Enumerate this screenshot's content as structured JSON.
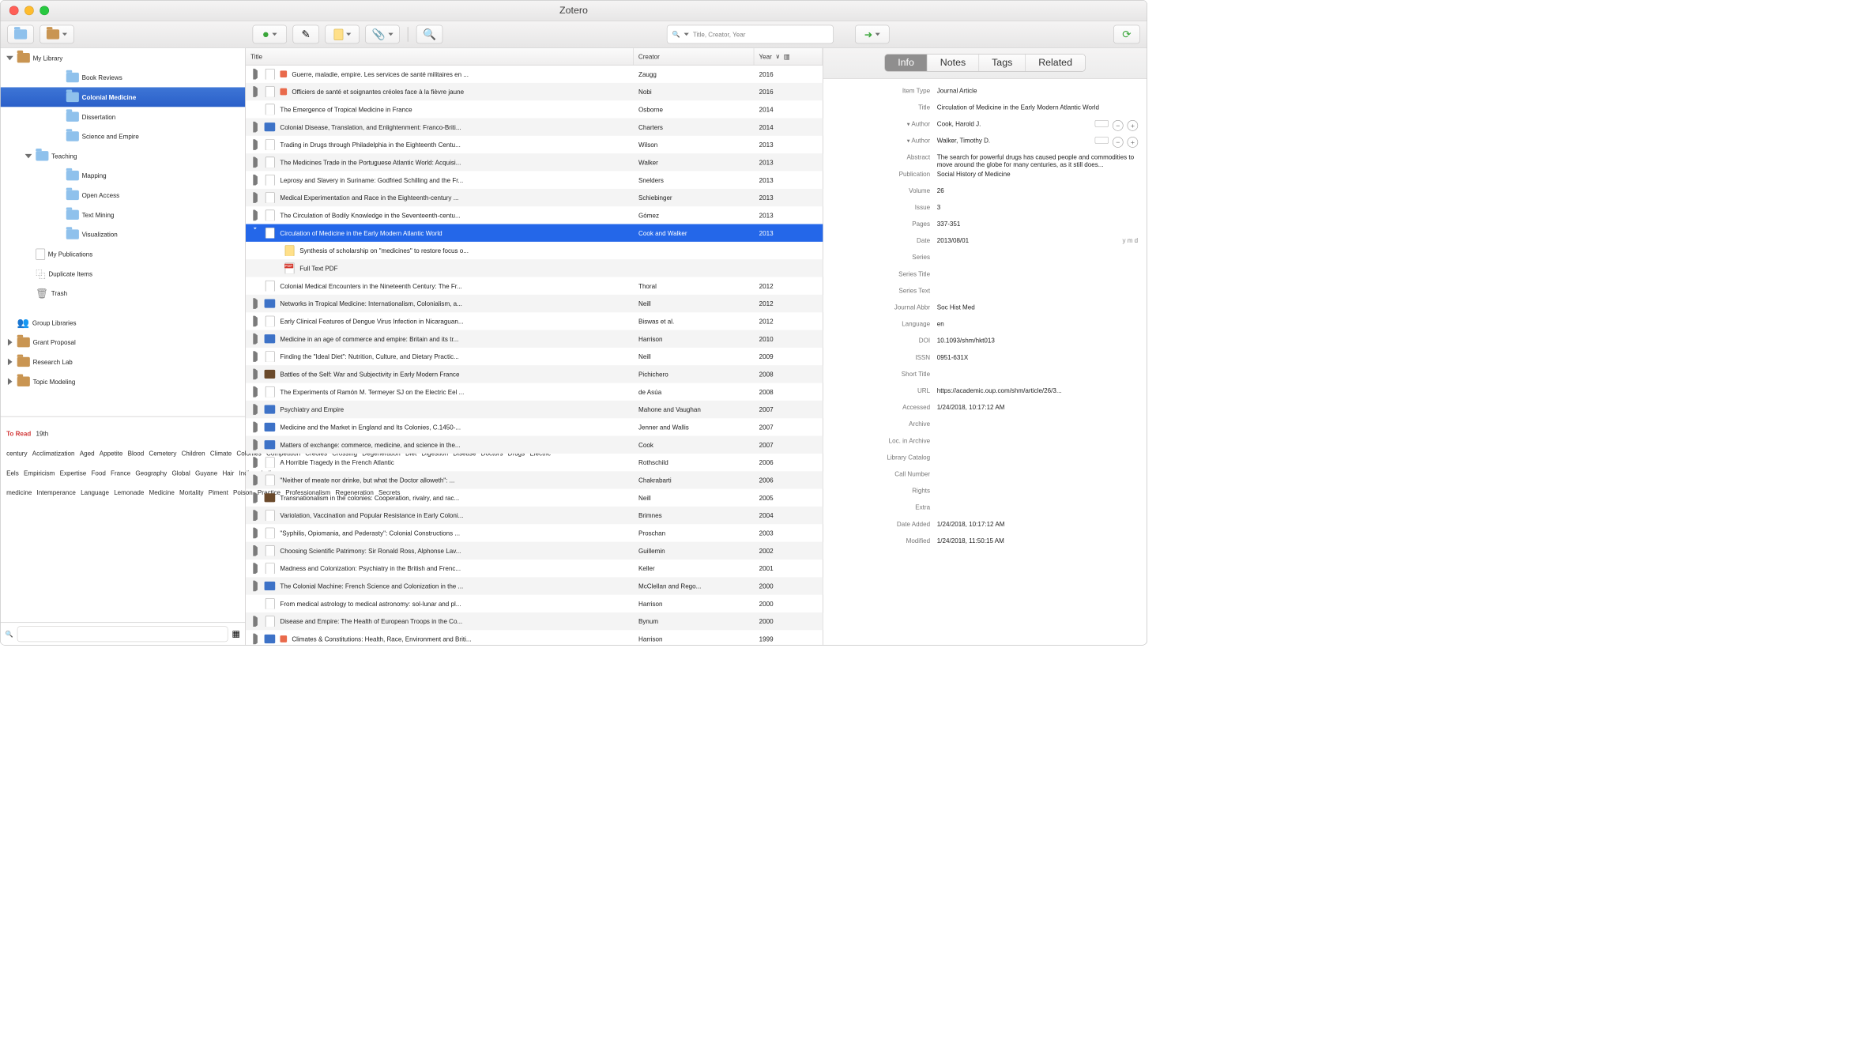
{
  "window": {
    "title": "Zotero"
  },
  "toolbar": {
    "search_placeholder": "Title, Creator, Year"
  },
  "tree": {
    "items": [
      {
        "label": "My Library",
        "depth": 0,
        "arrow": "down",
        "icon": "folder-br"
      },
      {
        "label": "Book Reviews",
        "depth": 2,
        "arrow": "none",
        "icon": "folder"
      },
      {
        "label": "Colonial Medicine",
        "depth": 2,
        "arrow": "none",
        "icon": "folder",
        "selected": true
      },
      {
        "label": "Dissertation",
        "depth": 2,
        "arrow": "none",
        "icon": "folder"
      },
      {
        "label": "Science and Empire",
        "depth": 2,
        "arrow": "none",
        "icon": "folder"
      },
      {
        "label": "Teaching",
        "depth": 1,
        "arrow": "down",
        "icon": "folder"
      },
      {
        "label": "Mapping",
        "depth": 2,
        "arrow": "none",
        "icon": "folder"
      },
      {
        "label": "Open Access",
        "depth": 2,
        "arrow": "none",
        "icon": "folder"
      },
      {
        "label": "Text Mining",
        "depth": 2,
        "arrow": "none",
        "icon": "folder"
      },
      {
        "label": "Visualization",
        "depth": 2,
        "arrow": "none",
        "icon": "folder"
      },
      {
        "label": "My Publications",
        "depth": 1,
        "arrow": "none",
        "icon": "doc"
      },
      {
        "label": "Duplicate Items",
        "depth": 1,
        "arrow": "none",
        "icon": "dup"
      },
      {
        "label": "Trash",
        "depth": 1,
        "arrow": "none",
        "icon": "trash"
      },
      {
        "label": "",
        "depth": 0,
        "arrow": "none",
        "icon": "spacer"
      },
      {
        "label": "Group Libraries",
        "depth": 0,
        "arrow": "none",
        "icon": "group"
      },
      {
        "label": "Grant Proposal",
        "depth": 0,
        "arrow": "right",
        "icon": "folder-br"
      },
      {
        "label": "Research Lab",
        "depth": 0,
        "arrow": "right",
        "icon": "folder-br"
      },
      {
        "label": "Topic Modeling",
        "depth": 0,
        "arrow": "right",
        "icon": "folder-br"
      }
    ]
  },
  "tags": [
    "To Read",
    "19th century",
    "Acclimatization",
    "Aged",
    "Appetite",
    "Blood",
    "Cemetery",
    "Children",
    "Climate",
    "Colonies",
    "Competition",
    "Creoles",
    "Crossing",
    "Degeneration",
    "Diet",
    "Digestion",
    "Disease",
    "Doctors",
    "Drugs",
    "Electric Eels",
    "Empiricism",
    "Expertise",
    "Food",
    "France",
    "Geography",
    "Global",
    "Guyane",
    "Hair",
    "Indies",
    "Indigenous medicine",
    "Intemperance",
    "Language",
    "Lemonade",
    "Medicine",
    "Mortality",
    "Piment",
    "Poison",
    "Practice",
    "Professionalism",
    "Regeneration",
    "Secrets"
  ],
  "columns": {
    "title": "Title",
    "creator": "Creator",
    "year": "Year"
  },
  "items": [
    {
      "arrow": "r",
      "icon": "doc",
      "tag": "red",
      "title": "Guerre, maladie, empire. Les services de santé militaires en ...",
      "creator": "Zaugg",
      "year": "2016"
    },
    {
      "arrow": "r",
      "icon": "doc",
      "tag": "red",
      "title": "Officiers de santé et soignantes créoles face à la fièvre jaune",
      "creator": "Nobi",
      "year": "2016"
    },
    {
      "arrow": "",
      "icon": "doc",
      "tag": "",
      "title": "The Emergence of Tropical Medicine in France",
      "creator": "Osborne",
      "year": "2014"
    },
    {
      "arrow": "r",
      "icon": "book",
      "tag": "",
      "title": "Colonial Disease, Translation, and Enlightenment: Franco-Briti...",
      "creator": "Charters",
      "year": "2014"
    },
    {
      "arrow": "r",
      "icon": "doc",
      "tag": "",
      "title": "Trading in Drugs through Philadelphia in the Eighteenth Centu...",
      "creator": "Wilson",
      "year": "2013"
    },
    {
      "arrow": "r",
      "icon": "doc",
      "tag": "",
      "title": "The Medicines Trade in the Portuguese Atlantic World: Acquisi...",
      "creator": "Walker",
      "year": "2013"
    },
    {
      "arrow": "r",
      "icon": "doc",
      "tag": "",
      "title": "Leprosy and Slavery in Suriname: Godfried Schilling and the Fr...",
      "creator": "Snelders",
      "year": "2013"
    },
    {
      "arrow": "r",
      "icon": "doc",
      "tag": "",
      "title": "Medical Experimentation and Race in the Eighteenth-century ...",
      "creator": "Schiebinger",
      "year": "2013"
    },
    {
      "arrow": "r",
      "icon": "doc",
      "tag": "",
      "title": "The Circulation of Bodily Knowledge in the Seventeenth-centu...",
      "creator": "Gómez",
      "year": "2013"
    },
    {
      "arrow": "d",
      "icon": "doc",
      "tag": "",
      "title": "Circulation of Medicine in the Early Modern Atlantic World",
      "creator": "Cook and Walker",
      "year": "2013",
      "selected": true
    },
    {
      "arrow": "",
      "icon": "note",
      "tag": "",
      "title": "Synthesis of scholarship on \"medicines\" to restore focus o...",
      "creator": "",
      "year": "",
      "child": true
    },
    {
      "arrow": "",
      "icon": "pdf",
      "tag": "",
      "title": "Full Text PDF",
      "creator": "",
      "year": "",
      "child": true
    },
    {
      "arrow": "",
      "icon": "doc",
      "tag": "",
      "title": "Colonial Medical Encounters in the Nineteenth Century: The Fr...",
      "creator": "Thoral",
      "year": "2012"
    },
    {
      "arrow": "r",
      "icon": "book",
      "tag": "",
      "title": "Networks in Tropical Medicine: Internationalism, Colonialism, a...",
      "creator": "Neill",
      "year": "2012"
    },
    {
      "arrow": "r",
      "icon": "doc",
      "tag": "",
      "title": "Early Clinical Features of Dengue Virus Infection in Nicaraguan...",
      "creator": "Biswas et al.",
      "year": "2012"
    },
    {
      "arrow": "r",
      "icon": "book",
      "tag": "",
      "title": "Medicine in an age of commerce and empire: Britain and its tr...",
      "creator": "Harrison",
      "year": "2010"
    },
    {
      "arrow": "r",
      "icon": "doc",
      "tag": "",
      "title": "Finding the \"Ideal Diet\": Nutrition, Culture, and Dietary Practic...",
      "creator": "Neill",
      "year": "2009"
    },
    {
      "arrow": "r",
      "icon": "bookdark",
      "tag": "",
      "title": "Battles of the Self: War and Subjectivity in Early Modern France",
      "creator": "Pichichero",
      "year": "2008"
    },
    {
      "arrow": "r",
      "icon": "doc",
      "tag": "",
      "title": "The Experiments of Ramón M. Termeyer SJ on the Electric Eel ...",
      "creator": "de Asúa",
      "year": "2008"
    },
    {
      "arrow": "r",
      "icon": "book",
      "tag": "",
      "title": "Psychiatry and Empire",
      "creator": "Mahone and Vaughan",
      "year": "2007"
    },
    {
      "arrow": "r",
      "icon": "book",
      "tag": "",
      "title": "Medicine and the Market in England and Its Colonies, C.1450-...",
      "creator": "Jenner and Wallis",
      "year": "2007"
    },
    {
      "arrow": "r",
      "icon": "book",
      "tag": "",
      "title": "Matters of exchange: commerce, medicine, and science in the...",
      "creator": "Cook",
      "year": "2007"
    },
    {
      "arrow": "r",
      "icon": "doc",
      "tag": "",
      "title": "A Horrible Tragedy in the French Atlantic",
      "creator": "Rothschild",
      "year": "2006"
    },
    {
      "arrow": "r",
      "icon": "doc",
      "tag": "",
      "title": "\"Neither of meate nor drinke, but what the Doctor alloweth\": ...",
      "creator": "Chakrabarti",
      "year": "2006"
    },
    {
      "arrow": "r",
      "icon": "bookdark",
      "tag": "",
      "title": "Transnationalism in the colonies: Cooperation, rivalry, and rac...",
      "creator": "Neill",
      "year": "2005"
    },
    {
      "arrow": "r",
      "icon": "doc",
      "tag": "",
      "title": "Variolation, Vaccination and Popular Resistance in Early Coloni...",
      "creator": "Brimnes",
      "year": "2004"
    },
    {
      "arrow": "r",
      "icon": "doc",
      "tag": "",
      "title": "\"Syphilis, Opiomania, and Pederasty\": Colonial Constructions ...",
      "creator": "Proschan",
      "year": "2003"
    },
    {
      "arrow": "r",
      "icon": "doc",
      "tag": "",
      "title": "Choosing Scientific Patrimony: Sir Ronald Ross, Alphonse Lav...",
      "creator": "Guillemin",
      "year": "2002"
    },
    {
      "arrow": "r",
      "icon": "doc",
      "tag": "",
      "title": "Madness and Colonization: Psychiatry in the British and Frenc...",
      "creator": "Keller",
      "year": "2001"
    },
    {
      "arrow": "r",
      "icon": "book",
      "tag": "",
      "title": "The Colonial Machine: French Science and Colonization in the ...",
      "creator": "McClellan and Rego...",
      "year": "2000"
    },
    {
      "arrow": "",
      "icon": "doc",
      "tag": "",
      "title": "From medical astrology to medical astronomy: sol-lunar and pl...",
      "creator": "Harrison",
      "year": "2000"
    },
    {
      "arrow": "r",
      "icon": "doc",
      "tag": "",
      "title": "Disease and Empire: The Health of European Troops in the Co...",
      "creator": "Bynum",
      "year": "2000"
    },
    {
      "arrow": "r",
      "icon": "book",
      "tag": "red",
      "title": "Climates & Constitutions: Health, Race, Environment and Briti...",
      "creator": "Harrison",
      "year": "1999"
    }
  ],
  "seg": {
    "info": "Info",
    "notes": "Notes",
    "tags": "Tags",
    "related": "Related"
  },
  "details": {
    "item_type_l": "Item Type",
    "item_type_v": "Journal Article",
    "title_l": "Title",
    "title_v": "Circulation of Medicine in the Early Modern Atlantic World",
    "author1_l": "Author",
    "author1_v": "Cook, Harold J.",
    "author2_l": "Author",
    "author2_v": "Walker, Timothy D.",
    "abstract_l": "Abstract",
    "abstract_v": "The search for powerful drugs has caused people and commodities to move around the globe for many centuries, as it still does...",
    "publication_l": "Publication",
    "publication_v": "Social History of Medicine",
    "volume_l": "Volume",
    "volume_v": "26",
    "issue_l": "Issue",
    "issue_v": "3",
    "pages_l": "Pages",
    "pages_v": "337-351",
    "date_l": "Date",
    "date_v": "2013/08/01",
    "date_hint": "y m d",
    "series_l": "Series",
    "series_v": "",
    "seriestitle_l": "Series Title",
    "seriestitle_v": "",
    "seriestext_l": "Series Text",
    "seriestext_v": "",
    "jabbr_l": "Journal Abbr",
    "jabbr_v": "Soc Hist Med",
    "language_l": "Language",
    "language_v": "en",
    "doi_l": "DOI",
    "doi_v": "10.1093/shm/hkt013",
    "issn_l": "ISSN",
    "issn_v": "0951-631X",
    "shorttitle_l": "Short Title",
    "shorttitle_v": "",
    "url_l": "URL",
    "url_v": "https://academic.oup.com/shm/article/26/3...",
    "accessed_l": "Accessed",
    "accessed_v": "1/24/2018, 10:17:12 AM",
    "archive_l": "Archive",
    "archive_v": "",
    "locarchive_l": "Loc. in Archive",
    "locarchive_v": "",
    "libcat_l": "Library Catalog",
    "libcat_v": "",
    "callnum_l": "Call Number",
    "callnum_v": "",
    "rights_l": "Rights",
    "rights_v": "",
    "extra_l": "Extra",
    "extra_v": "",
    "dateadded_l": "Date Added",
    "dateadded_v": "1/24/2018, 10:17:12 AM",
    "modified_l": "Modified",
    "modified_v": "1/24/2018, 11:50:15 AM"
  }
}
